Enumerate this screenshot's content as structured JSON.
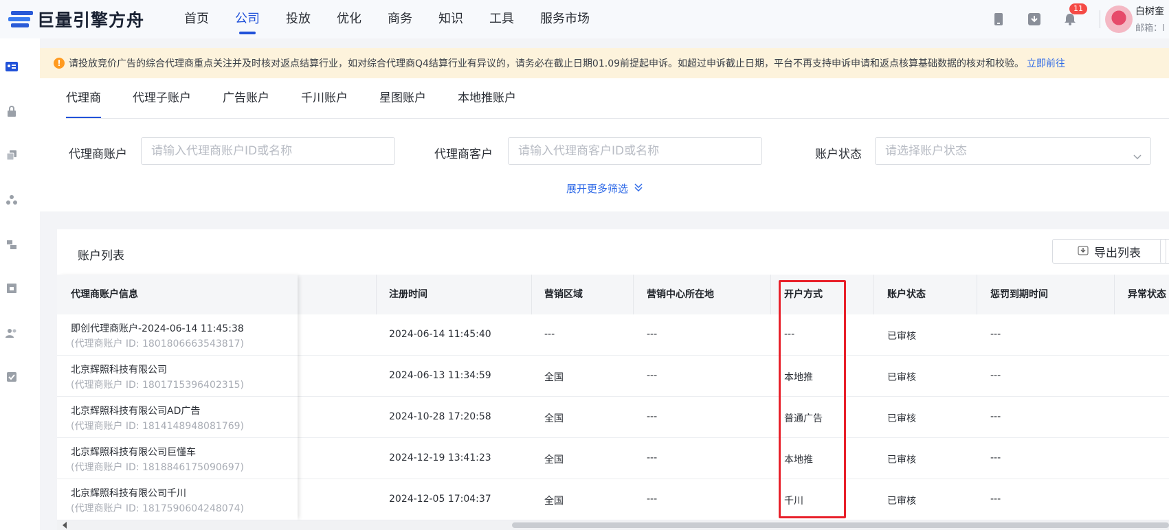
{
  "header": {
    "brand": "巨量引擎方舟",
    "nav": [
      {
        "label": "首页",
        "active": false
      },
      {
        "label": "公司",
        "active": true
      },
      {
        "label": "投放",
        "active": false
      },
      {
        "label": "优化",
        "active": false
      },
      {
        "label": "商务",
        "active": false
      },
      {
        "label": "知识",
        "active": false
      },
      {
        "label": "工具",
        "active": false
      },
      {
        "label": "服务市场",
        "active": false
      }
    ],
    "notification_count": "11",
    "user_name": "白树奎",
    "user_email_label": "邮箱：l"
  },
  "notice": {
    "text": "请投放竞价广告的综合代理商重点关注并及时核对返点结算行业，如对综合代理商Q4结算行业有异议的，请务必在截止日期01.09前提起申诉。如超过申诉截止日期，平台不再支持申诉申请和返点核算基础数据的核对和校验。",
    "link": "立即前往"
  },
  "tabs": [
    "代理商",
    "代理子账户",
    "广告账户",
    "千川账户",
    "星图账户",
    "本地推账户"
  ],
  "filters": {
    "agent_account_label": "代理商账户",
    "agent_account_placeholder": "请输入代理商账户ID或名称",
    "agent_client_label": "代理商客户",
    "agent_client_placeholder": "请输入代理商客户ID或名称",
    "status_label": "账户状态",
    "status_placeholder": "请选择账户状态",
    "expand": "展开更多筛选"
  },
  "table": {
    "title": "账户列表",
    "export": "导出列表",
    "columns": [
      "代理商账户信息",
      "注册时间",
      "营销区域",
      "营销中心所在地",
      "开户方式",
      "账户状态",
      "惩罚到期时间",
      "异常状态"
    ],
    "rows": [
      {
        "name": "即创代理商账户-2024-06-14 11:45:38",
        "id": "(代理商账户 ID: 1801806663543817)",
        "reg": "2024-06-14 11:45:40",
        "region": "---",
        "center": "---",
        "open": "---",
        "status": "已审核",
        "penalty": "---"
      },
      {
        "name": "北京辉照科技有限公司",
        "id": "(代理商账户 ID: 1801715396402315)",
        "reg": "2024-06-13 11:34:59",
        "region": "全国",
        "center": "---",
        "open": "本地推",
        "status": "已审核",
        "penalty": "---"
      },
      {
        "name": "北京辉照科技有限公司AD广告",
        "id": "(代理商账户 ID: 1814148948081769)",
        "reg": "2024-10-28 17:20:58",
        "region": "全国",
        "center": "---",
        "open": "普通广告",
        "status": "已审核",
        "penalty": "---"
      },
      {
        "name": "北京辉照科技有限公司巨懂车",
        "id": "(代理商账户 ID: 1818846175090697)",
        "reg": "2024-12-19 13:41:23",
        "region": "全国",
        "center": "---",
        "open": "本地推",
        "status": "已审核",
        "penalty": "---"
      },
      {
        "name": "北京辉照科技有限公司千川",
        "id": "(代理商账户 ID: 1817590604248074)",
        "reg": "2024-12-05 17:04:37",
        "region": "全国",
        "center": "---",
        "open": "千川",
        "status": "已审核",
        "penalty": "---"
      }
    ]
  },
  "colors": {
    "accent": "#2152d9",
    "link": "#2f6ae7",
    "highlight": "#e8202a",
    "notice_bg": "#fdf3dc"
  }
}
